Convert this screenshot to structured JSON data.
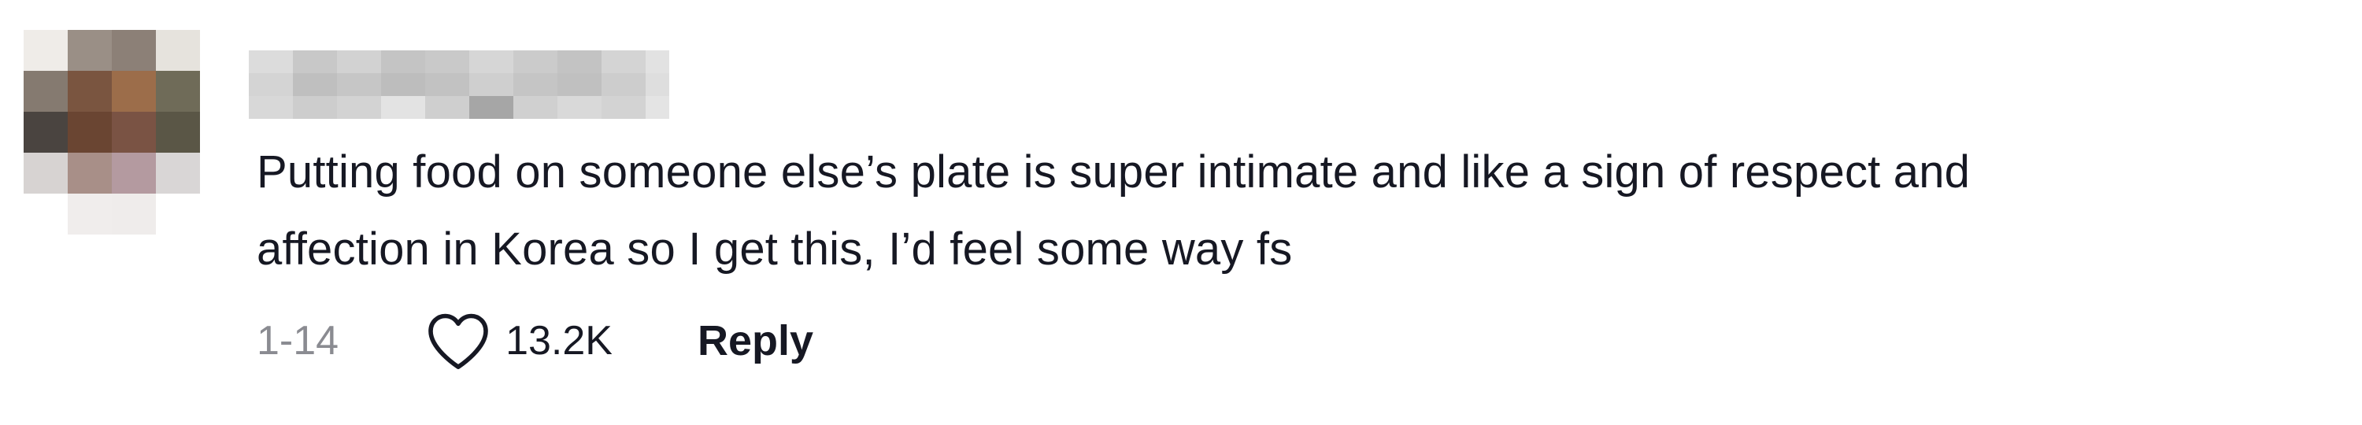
{
  "comment": {
    "text_line_1": "Putting food on someone else’s plate is super intimate and like a sign of respect and",
    "text_line_2": "affection in Korea so I get this, I’d feel some way fs",
    "date": "1-14",
    "like_count": "13.2K",
    "reply_label": "Reply"
  },
  "icons": {
    "like": "heart-outline-icon"
  },
  "colors": {
    "text": "#161823",
    "secondary_text": "#8a8b91",
    "background": "#ffffff"
  }
}
